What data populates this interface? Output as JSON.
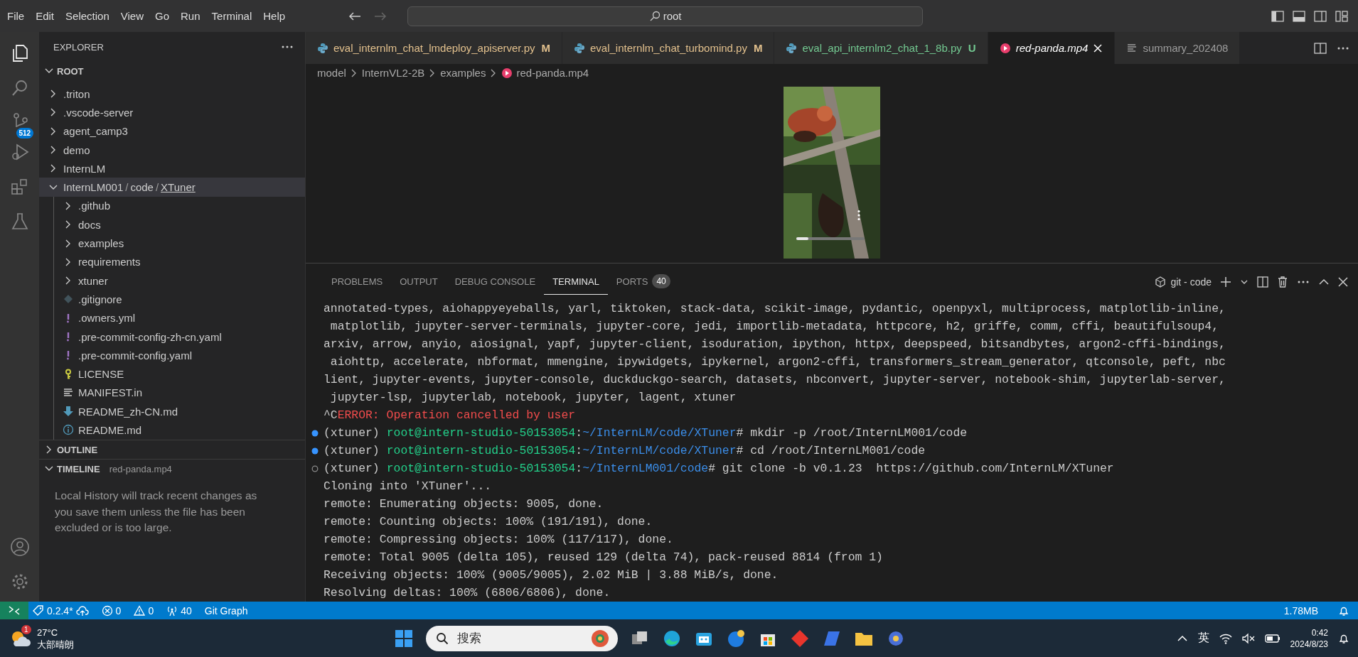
{
  "menu": [
    "File",
    "Edit",
    "Selection",
    "View",
    "Go",
    "Run",
    "Terminal",
    "Help"
  ],
  "search": {
    "value": "root"
  },
  "activity_bar": {
    "source_control_badge": "512"
  },
  "explorer": {
    "title": "EXPLORER",
    "root": "ROOT",
    "items": [
      {
        "kind": "folder",
        "label": ".triton",
        "expanded": false,
        "selected": false
      },
      {
        "kind": "folder",
        "label": ".vscode-server",
        "expanded": false,
        "selected": false
      },
      {
        "kind": "folder",
        "label": "agent_camp3",
        "expanded": false,
        "selected": false
      },
      {
        "kind": "folder",
        "label": "demo",
        "expanded": false,
        "selected": false
      },
      {
        "kind": "folder",
        "label": "InternLM",
        "expanded": false,
        "selected": false
      },
      {
        "kind": "folder",
        "segments": [
          "InternLM001",
          "code",
          "XTuner"
        ],
        "separator": "/",
        "expanded": true,
        "selected": true,
        "children": [
          {
            "kind": "folder",
            "label": ".github",
            "expanded": false,
            "selected": false
          },
          {
            "kind": "folder",
            "label": "docs",
            "expanded": false,
            "selected": false
          },
          {
            "kind": "folder",
            "label": "examples",
            "expanded": false,
            "selected": false
          },
          {
            "kind": "folder",
            "label": "requirements",
            "expanded": false,
            "selected": false
          },
          {
            "kind": "folder",
            "label": "xtuner",
            "expanded": false,
            "selected": false
          },
          {
            "kind": "git",
            "label": ".gitignore",
            "selected": false
          },
          {
            "kind": "yaml",
            "label": ".owners.yml",
            "selected": false
          },
          {
            "kind": "yaml",
            "label": ".pre-commit-config-zh-cn.yaml",
            "selected": false
          },
          {
            "kind": "yaml",
            "label": ".pre-commit-config.yaml",
            "selected": false
          },
          {
            "kind": "license",
            "label": "LICENSE",
            "selected": false
          },
          {
            "kind": "text",
            "label": "MANIFEST.in",
            "selected": false
          },
          {
            "kind": "markdown",
            "label": "README_zh-CN.md",
            "selected": false
          },
          {
            "kind": "info",
            "label": "README.md",
            "selected": false
          }
        ]
      }
    ]
  },
  "outline": {
    "title": "OUTLINE",
    "expanded": false
  },
  "timeline": {
    "title": "TIMELINE",
    "file": "red-panda.mp4",
    "expanded": true,
    "message": "Local History will track recent changes as you save them unless the file has been excluded or is too large."
  },
  "tabs": [
    {
      "kind": "python",
      "label": "eval_internlm_chat_lmdeploy_apiserver.py",
      "status": "M",
      "color": "#e2c08d",
      "selected": false,
      "italic": false
    },
    {
      "kind": "python",
      "label": "eval_internlm_chat_turbomind.py",
      "status": "M",
      "color": "#e2c08d",
      "selected": false,
      "italic": false
    },
    {
      "kind": "python",
      "label": "eval_api_internlm2_chat_1_8b.py",
      "status": "U",
      "color": "#73c991",
      "selected": false,
      "italic": false
    },
    {
      "kind": "video",
      "label": "red-panda.mp4",
      "color": "#ffffff",
      "selected": true,
      "italic": true
    },
    {
      "kind": "text",
      "label": "summary_202408",
      "color": "#9d9d9d",
      "selected": false,
      "italic": false
    }
  ],
  "breadcrumb": [
    {
      "kind": "folder",
      "label": "model"
    },
    {
      "kind": "folder",
      "label": "InternVL2-2B"
    },
    {
      "kind": "folder",
      "label": "examples"
    },
    {
      "kind": "video",
      "label": "red-panda.mp4"
    }
  ],
  "video": {
    "kind": "picture",
    "level": 0.18
  },
  "panel": {
    "tabs": [
      {
        "label": "PROBLEMS",
        "selected": false
      },
      {
        "label": "OUTPUT",
        "selected": false
      },
      {
        "label": "DEBUG CONSOLE",
        "selected": false
      },
      {
        "label": "TERMINAL",
        "selected": true
      },
      {
        "label": "PORTS",
        "badge": "40",
        "selected": false
      }
    ],
    "terminal_name": "git - code"
  },
  "terminal": [
    {
      "kind": "plain",
      "text": "annotated-types, aiohappyeyeballs, yarl, tiktoken, stack-data, scikit-image, pydantic, openpyxl, multiprocess, matplotlib-inline,"
    },
    {
      "kind": "plain",
      "text": " matplotlib, jupyter-server-terminals, jupyter-core, jedi, importlib-metadata, httpcore, h2, griffe, comm, cffi, beautifulsoup4,"
    },
    {
      "kind": "plain",
      "text": "arxiv, arrow, anyio, aiosignal, yapf, jupyter-client, isoduration, ipython, httpx, deepspeed, bitsandbytes, argon2-cffi-bindings,"
    },
    {
      "kind": "plain",
      "text": " aiohttp, accelerate, nbformat, mmengine, ipywidgets, ipykernel, argon2-cffi, transformers_stream_generator, qtconsole, peft, nbc"
    },
    {
      "kind": "plain",
      "text": "lient, jupyter-events, jupyter-console, duckduckgo-search, datasets, nbconvert, jupyter-server, notebook-shim, jupyterlab-server,"
    },
    {
      "kind": "plain",
      "text": " jupyter-lsp, jupyterlab, notebook, jupyter, lagent, xtuner"
    },
    {
      "kind": "error",
      "prefix": "^C",
      "text": "ERROR: Operation cancelled by user"
    },
    {
      "kind": "prompt",
      "done": true,
      "env": "(xtuner)",
      "user": "root@intern-studio-50153054",
      "sep": ":",
      "path": "~/InternLM/code/XTuner",
      "command": "# mkdir -p /root/InternLM001/code"
    },
    {
      "kind": "prompt",
      "done": true,
      "env": "(xtuner)",
      "user": "root@intern-studio-50153054",
      "sep": ":",
      "path": "~/InternLM/code/XTuner",
      "command": "# cd /root/InternLM001/code"
    },
    {
      "kind": "prompt",
      "done": false,
      "env": "(xtuner)",
      "user": "root@intern-studio-50153054",
      "sep": ":",
      "path": "~/InternLM001/code",
      "command": "# git clone -b v0.1.23  https://github.com/InternLM/XTuner"
    },
    {
      "kind": "plain",
      "text": "Cloning into 'XTuner'..."
    },
    {
      "kind": "plain",
      "text": "remote: Enumerating objects: 9005, done."
    },
    {
      "kind": "plain",
      "text": "remote: Counting objects: 100% (191/191), done."
    },
    {
      "kind": "plain",
      "text": "remote: Compressing objects: 100% (117/117), done."
    },
    {
      "kind": "plain",
      "text": "remote: Total 9005 (delta 105), reused 129 (delta 74), pack-reused 8814 (from 1)"
    },
    {
      "kind": "plain",
      "text": "Receiving objects: 100% (9005/9005), 2.02 MiB | 3.88 MiB/s, done."
    },
    {
      "kind": "plain",
      "text": "Resolving deltas: 100% (6806/6806), done."
    }
  ],
  "status_bar": {
    "left": [
      {
        "kind": "tag",
        "text": "0.2.4*"
      },
      {
        "kind": "errors",
        "text": "0"
      },
      {
        "kind": "warnings",
        "text": "0"
      },
      {
        "kind": "ports",
        "text": "40"
      },
      {
        "kind": "plain",
        "text": "Git Graph"
      }
    ],
    "right": [
      {
        "kind": "plain",
        "text": "1.78MB"
      }
    ]
  },
  "taskbar": {
    "weather_badge": "1",
    "temperature": "27°C",
    "weather": "大部晴朗",
    "search_placeholder": "搜索",
    "input_method": "英",
    "time": "0:42",
    "date": "2024/8/23"
  }
}
